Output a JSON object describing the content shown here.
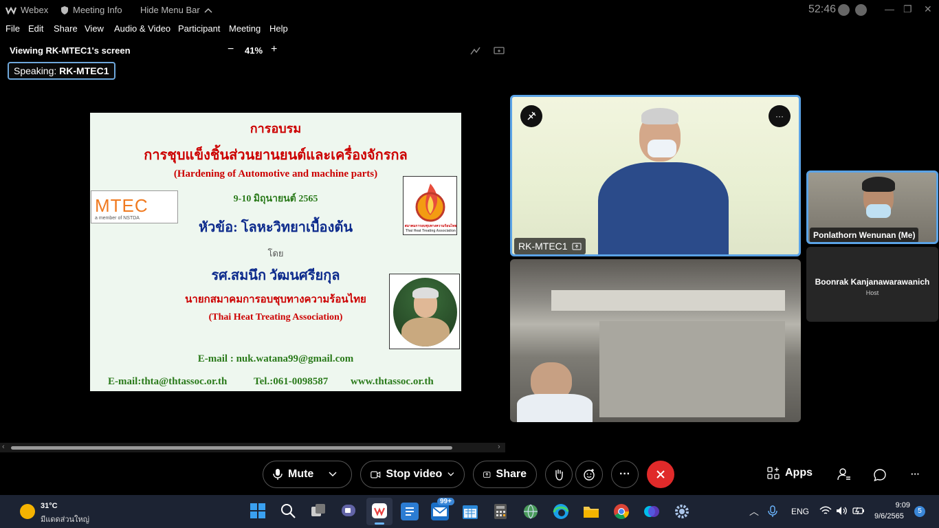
{
  "titlebar": {
    "app_name": "Webex",
    "meeting_info": "Meeting Info",
    "hide_menu": "Hide Menu Bar",
    "timer": "52:46"
  },
  "menu": [
    "File",
    "Edit",
    "Share",
    "View",
    "Audio & Video",
    "Participant",
    "Meeting",
    "Help"
  ],
  "viewer": {
    "title": "Viewing RK-MTEC1's screen",
    "zoom": "41%",
    "speaking_label": "Speaking:",
    "speaking_name": "RK-MTEC1"
  },
  "slide": {
    "line1": "การอบรม",
    "line2": "การชุบแข็งชิ้นส่วนยานยนต์และเครื่องจักรกล",
    "line3": "(Hardening of Automotive and machine parts)",
    "line4": "9-10 มิถุนายนต์ 2565",
    "line5": "หัวข้อ: โลหะวิทยาเบื้องต้น",
    "line6": "โดย",
    "line7": "รศ.สมนึก  วัฒนศรียกุล",
    "line8": "นายกสมาคมการอบชุบทางความร้อนไทย",
    "line9": "(Thai Heat Treating Association)",
    "email1": "E-mail : nuk.watana99@gmail.com",
    "email2": "E-mail:thta@thtassoc.or.th",
    "tel": "Tel.:061-0098587",
    "web": "www.thtassoc.or.th",
    "logo_left": "MTEC",
    "logo_left_sub": "a member of NSTDA",
    "logo_right_sub1": "สมาคมการอบชุบทางความร้อนไทย",
    "logo_right_sub2": "Thai Heat Treating Association"
  },
  "participants": {
    "main_name": "RK-MTEC1",
    "self_name": "Ponlathorn Wenunan (Me)",
    "host_name": "Boonrak Kanjanawarawanich",
    "host_role": "Host"
  },
  "controls": {
    "mute": "Mute",
    "stop_video": "Stop video",
    "share": "Share",
    "apps": "Apps",
    "more": "···"
  },
  "taskbar": {
    "weather_temp": "31°C",
    "weather_desc": "มีแดดส่วนใหญ่",
    "mail_badge": "99+",
    "lang": "ENG",
    "time": "9:09",
    "date": "9/6/2565",
    "notif_count": "5"
  }
}
